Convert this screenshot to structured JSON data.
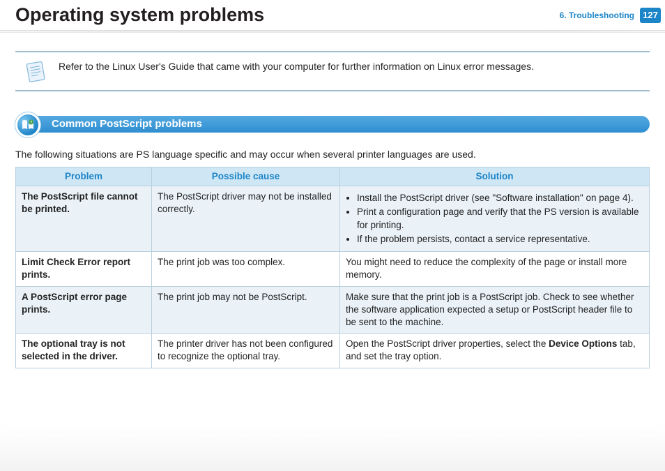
{
  "header": {
    "title": "Operating system problems",
    "chapter": "6.  Troubleshooting",
    "page_number": "127"
  },
  "note": {
    "text": "Refer to the Linux User's Guide that came with your computer for further information on Linux error messages."
  },
  "section": {
    "title": "Common PostScript problems"
  },
  "intro": "The following situations are PS language specific and may occur when several printer languages are used.",
  "table": {
    "headers": {
      "problem": "Problem",
      "cause": "Possible cause",
      "solution": "Solution"
    },
    "rows": [
      {
        "problem": "The PostScript file cannot be printed.",
        "cause": "The PostScript driver may not be installed correctly.",
        "solution_list": [
          "Install the PostScript driver (see \"Software installation\" on page 4).",
          "Print a configuration page and verify that the PS version is available for printing.",
          "If the problem persists, contact a service representative."
        ]
      },
      {
        "problem": "Limit Check Error report prints.",
        "cause": "The print job was too complex.",
        "solution": "You might need to reduce the complexity of the page or install more memory."
      },
      {
        "problem": "A PostScript error page prints.",
        "cause": "The print job may not be PostScript.",
        "solution": "Make sure that the print job is a PostScript job. Check to see whether the software application expected a setup or PostScript header file to be sent to the machine."
      },
      {
        "problem": "The optional tray is not selected in the driver.",
        "cause": "The printer driver has not been configured to recognize the optional tray.",
        "solution_pre": "Open the PostScript driver properties, select the ",
        "solution_bold": "Device Options",
        "solution_post": " tab, and set the tray option."
      }
    ]
  }
}
